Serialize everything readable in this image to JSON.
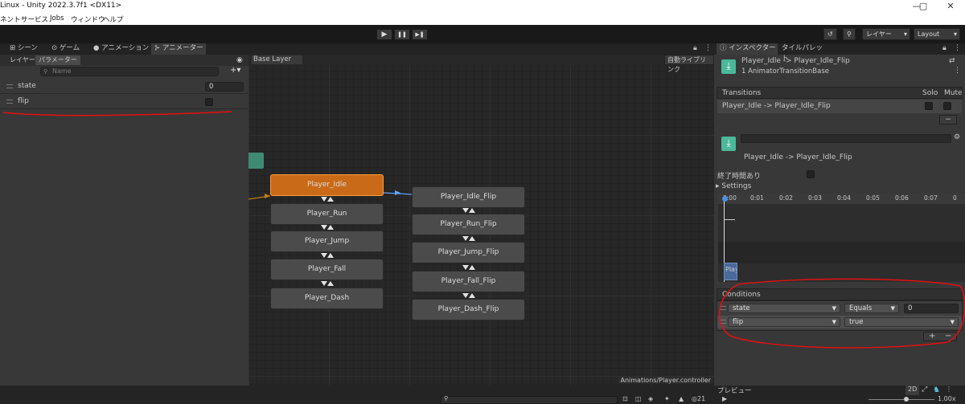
{
  "window": {
    "title": "Linux - Unity 2022.3.7f1 <DX11>",
    "min": "—",
    "max": "▢",
    "close": "✕"
  },
  "menu": [
    "ネント",
    "サービス",
    "Jobs",
    "ウィンドウ",
    "ヘルプ"
  ],
  "toolbar": {
    "play": "▶",
    "pause": "❚❚",
    "step": "▶❚",
    "history_icon": "↺",
    "search_icon": "⚲",
    "layers": "レイヤー",
    "layout": "Layout"
  },
  "tabs": [
    "シーン",
    "ゲーム",
    "アニメーション",
    "アニメーター"
  ],
  "animator": {
    "subtabs": [
      "レイヤー",
      "パラメーター"
    ],
    "search_placeholder": "Name",
    "add": "+▾",
    "params": [
      {
        "name": "state",
        "value": "0",
        "type": "int"
      },
      {
        "name": "flip",
        "value": false,
        "type": "bool"
      }
    ],
    "breadcrumb": "Base Layer",
    "auto_live": "自動ライブリンク",
    "nodes_left": [
      "Player_Idle",
      "Player_Run",
      "Player_Jump",
      "Player_Fall",
      "Player_Dash"
    ],
    "nodes_right": [
      "Player_Idle_Flip",
      "Player_Run_Flip",
      "Player_Jump_Flip",
      "Player_Fall_Flip",
      "Player_Dash_Flip"
    ],
    "footer_path": "Animations/Player.controller"
  },
  "inspector": {
    "tabs": [
      "インスペクター",
      "タイルパレット"
    ],
    "title": "Player_Idle -> Player_Idle_Flip",
    "subtitle": "1 AnimatorTransitionBase",
    "transitions_header": "Transitions",
    "solo": "Solo",
    "mute": "Mute",
    "transition_row": "Player_Idle -> Player_Idle_Flip",
    "minus": "−",
    "transition_name": "Player_Idle -> Player_Idle_Flip",
    "has_exit_time": "終了時間あり",
    "settings": "Settings",
    "ticks": [
      "0:00",
      "0:01",
      "0:02",
      "0:03",
      "0:04",
      "0:05",
      "0:06",
      "0:07",
      "0"
    ],
    "clip_label": "Play",
    "conditions_header": "Conditions",
    "conditions": [
      {
        "param": "state",
        "mode": "Equals",
        "value": "0"
      },
      {
        "param": "flip",
        "mode": "true",
        "value": ""
      }
    ],
    "plus": "+",
    "minus2": "−"
  },
  "statusbar": {
    "preview": "プレビュー",
    "twod": "2D",
    "zoom": "1.00x",
    "count": "21"
  },
  "annotation_color": "#e60f0f"
}
